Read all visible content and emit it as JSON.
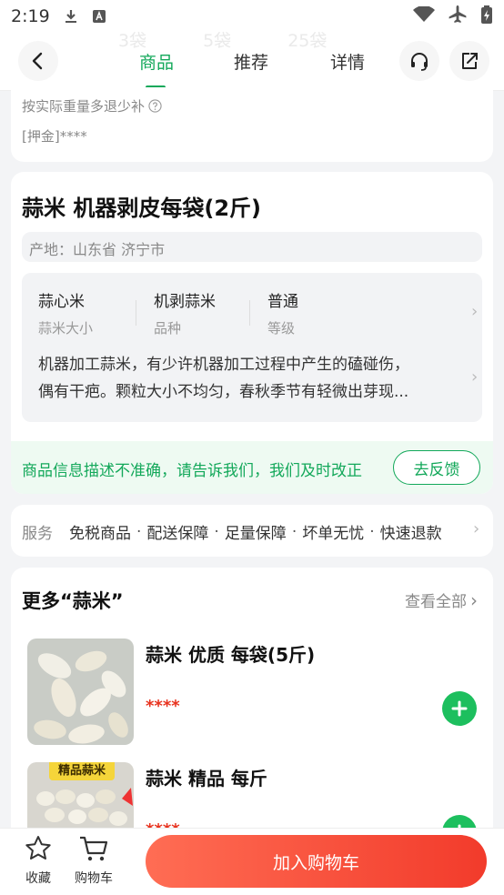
{
  "status_bar": {
    "time": "2:19"
  },
  "nav": {
    "tabs": [
      {
        "label": "商品"
      },
      {
        "label": "推荐"
      },
      {
        "label": "详情"
      }
    ],
    "active_tab": 0,
    "faded_quantities": [
      "3袋",
      "5袋",
      "25袋"
    ]
  },
  "top_card": {
    "note": "按实际重量多退少补",
    "deposit": "[押金]****"
  },
  "product": {
    "title": "蒜米 机器剥皮每袋(2斤)",
    "origin": "产地：山东省 济宁市",
    "specs": [
      {
        "value": "蒜心米",
        "label": "蒜米大小"
      },
      {
        "value": "机剥蒜米",
        "label": "品种"
      },
      {
        "value": "普通",
        "label": "等级"
      }
    ],
    "description_line1": "机器加工蒜米，有少许机器加工过程中产生的磕碰伤，",
    "description_line2": "偶有干疤。颗粒大小不均匀，春秋季节有轻微出芽现..."
  },
  "feedback": {
    "text": "商品信息描述不准确，请告诉我们，我们及时改正",
    "button": "去反馈"
  },
  "service": {
    "label": "服务",
    "items": [
      "免税商品",
      "配送保障",
      "足量保障",
      "坏单无忧",
      "快速退款"
    ]
  },
  "more": {
    "title": "更多“蒜米”",
    "view_all": "查看全部",
    "items": [
      {
        "name": "蒜米 优质 每袋(5斤)",
        "price": "****"
      },
      {
        "name": "蒜米 精品 每斤",
        "price": "****",
        "badge": "精品蒜米"
      }
    ]
  },
  "bottom": {
    "favorite": "收藏",
    "cart": "购物车",
    "add_to_cart": "加入购物车"
  },
  "colors": {
    "accent": "#13a85a",
    "price": "#e8321e",
    "cta": "#f23b2b"
  }
}
